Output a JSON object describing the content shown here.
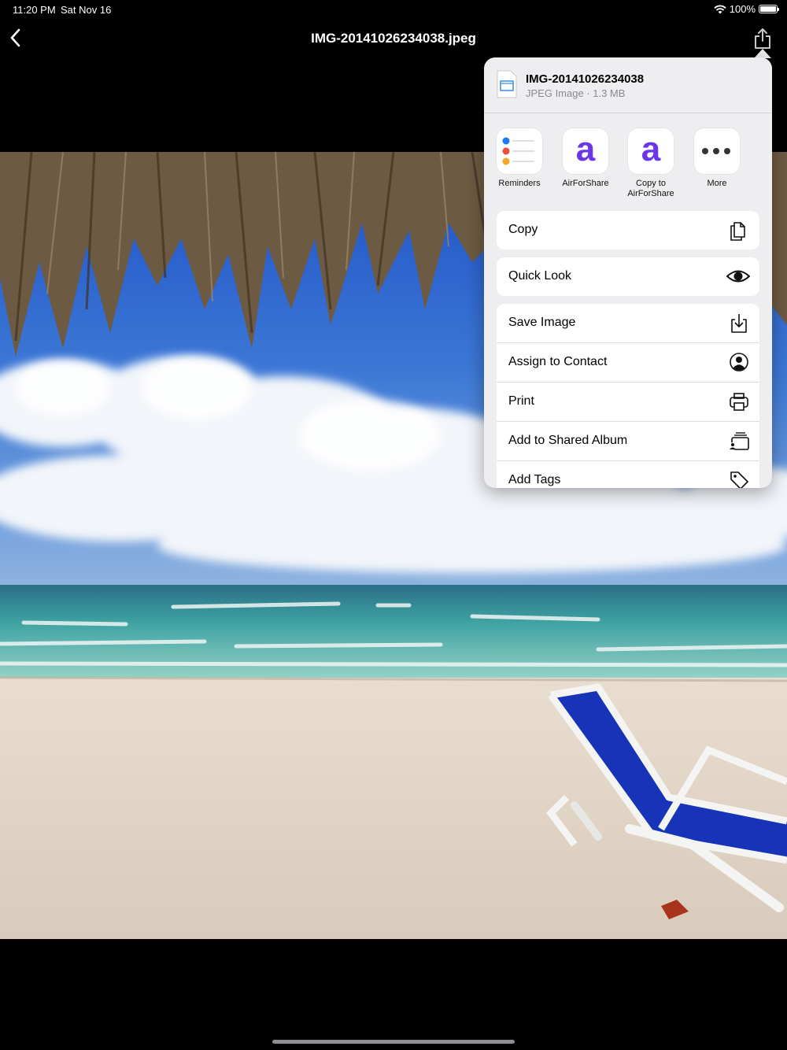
{
  "status_bar": {
    "time": "11:20 PM",
    "date": "Sat Nov 16",
    "battery": "100%"
  },
  "nav": {
    "title": "IMG-20141026234038.jpeg"
  },
  "share_sheet": {
    "file_name": "IMG-20141026234038",
    "file_meta": "JPEG Image · 1.3 MB",
    "apps": [
      {
        "label": "Reminders",
        "icon": "reminders-icon"
      },
      {
        "label": "AirForShare",
        "icon": "airforshare-icon",
        "glyph": "a"
      },
      {
        "label": "Copy to AirForShare",
        "icon": "airforshare-icon",
        "glyph": "a"
      },
      {
        "label": "More",
        "icon": "more-icon"
      }
    ],
    "actions": [
      {
        "label": "Copy",
        "icon": "copy-icon"
      },
      {
        "label": "Quick Look",
        "icon": "eye-icon"
      },
      {
        "label": "Save Image",
        "icon": "save-icon"
      },
      {
        "label": "Assign to Contact",
        "icon": "contact-icon"
      },
      {
        "label": "Print",
        "icon": "printer-icon"
      },
      {
        "label": "Add to Shared Album",
        "icon": "shared-album-icon"
      },
      {
        "label": "Add Tags",
        "icon": "tag-icon"
      }
    ]
  },
  "colors": {
    "airforshare": "#6b35e8",
    "background": "#000000",
    "sheet": "#eeeef1"
  }
}
